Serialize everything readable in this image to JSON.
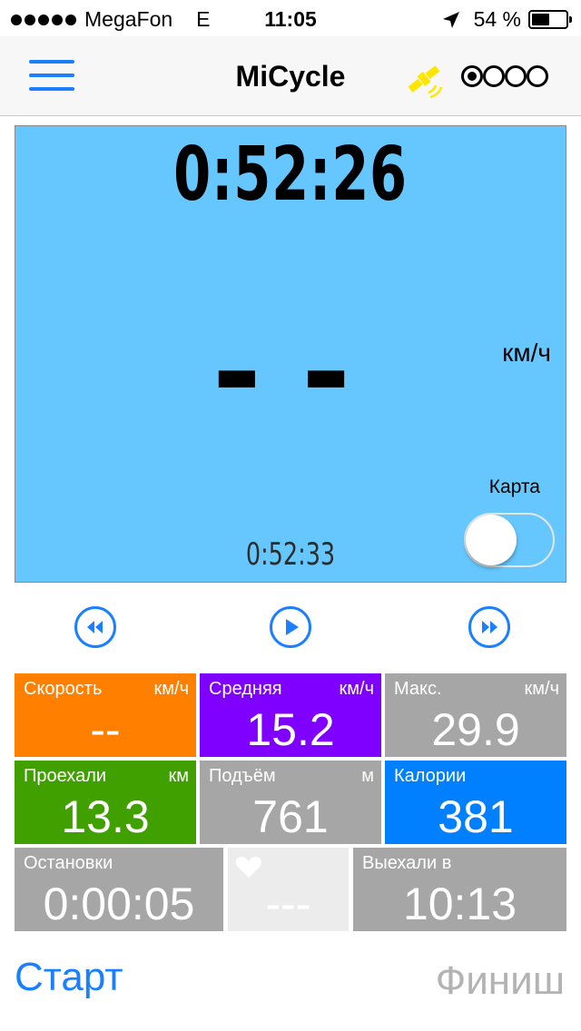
{
  "status_bar": {
    "carrier": "MegaFon",
    "network": "E",
    "time": "11:05",
    "battery": "54 %",
    "battery_level": 0.54
  },
  "nav": {
    "title": "MiCycle"
  },
  "display": {
    "total_time": "0:52:26",
    "speed": "--",
    "speed_unit": "км/ч",
    "map_label": "Карта",
    "moving_time": "0:52:33"
  },
  "tiles": {
    "speed": {
      "label": "Скорость",
      "unit": "км/ч",
      "value": "--",
      "color": "#ff8000"
    },
    "average": {
      "label": "Средняя",
      "unit": "км/ч",
      "value": "15.2",
      "color": "#8000ff"
    },
    "max": {
      "label": "Макс.",
      "unit": "км/ч",
      "value": "29.9",
      "color": "#a6a6a6"
    },
    "distance": {
      "label": "Проехали",
      "unit": "км",
      "value": "13.3",
      "color": "#40a000"
    },
    "climb": {
      "label": "Подъём",
      "unit": "м",
      "value": "761",
      "color": "#a6a6a6"
    },
    "calories": {
      "label": "Калории",
      "unit": "",
      "value": "381",
      "color": "#0080ff"
    },
    "stops": {
      "label": "Остановки",
      "value": "0:00:05",
      "color": "#a6a6a6"
    },
    "heart": {
      "value": "---",
      "color": "#ececec"
    },
    "departed": {
      "label": "Выехали в",
      "value": "10:13",
      "color": "#a6a6a6"
    }
  },
  "actions": {
    "start": "Старт",
    "finish": "Финиш"
  },
  "colors": {
    "accent": "#1a80ff",
    "panel_bg": "#66c7ff",
    "gps_icon": "#ffe600"
  },
  "icons": {
    "menu": "hamburger-icon",
    "gps": "satellite-icon",
    "rewind": "rewind-icon",
    "play": "play-icon",
    "forward": "fast-forward-icon",
    "heart": "heart-icon"
  }
}
